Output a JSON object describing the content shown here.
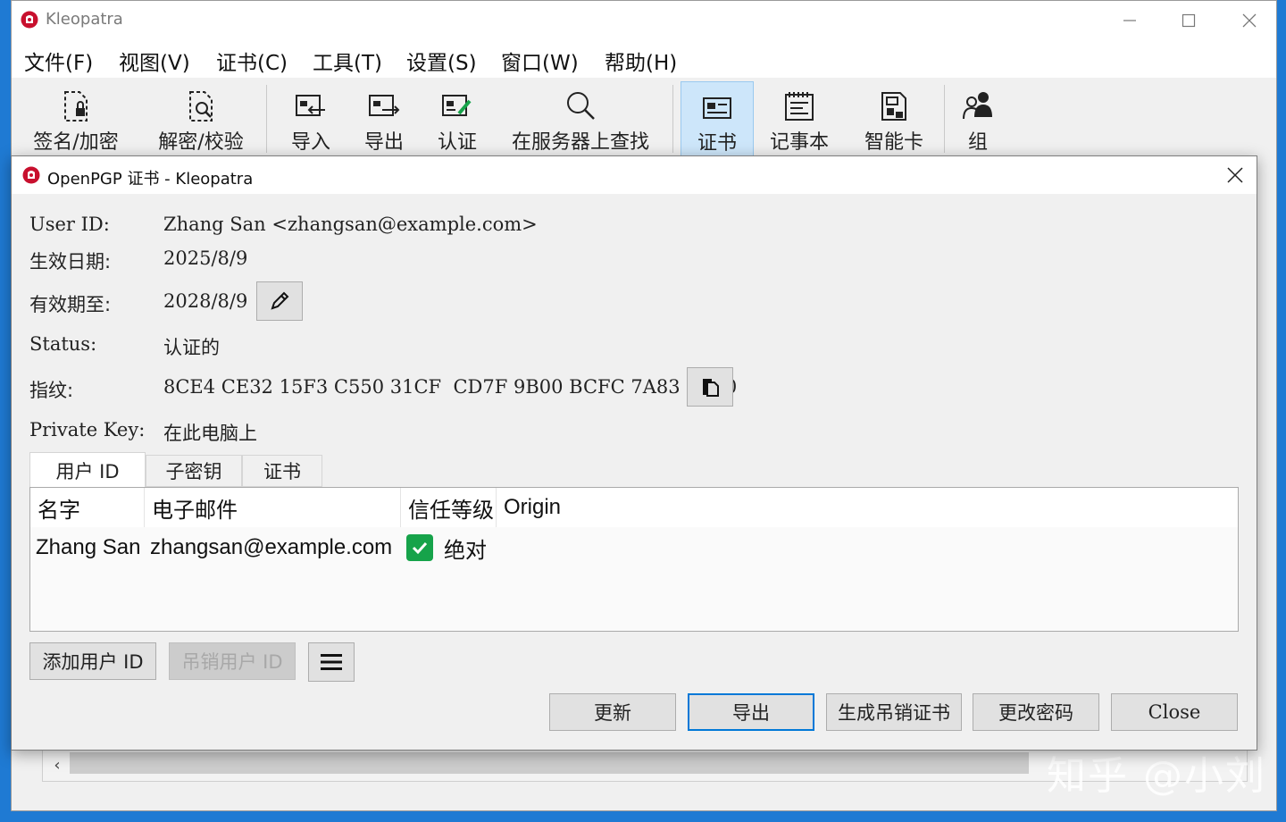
{
  "window": {
    "title": "Kleopatra",
    "minimize_glyph": "─",
    "maximize_glyph": "☐",
    "close_glyph": "✕"
  },
  "menu": [
    {
      "label": "文件(F)"
    },
    {
      "label": "视图(V)"
    },
    {
      "label": "证书(C)"
    },
    {
      "label": "工具(T)"
    },
    {
      "label": "设置(S)"
    },
    {
      "label": "窗口(W)"
    },
    {
      "label": "帮助(H)"
    }
  ],
  "toolbar": [
    {
      "label": "签名/加密",
      "icon": "sign-encrypt-icon"
    },
    {
      "label": "解密/校验",
      "icon": "decrypt-verify-icon"
    },
    {
      "label": "导入",
      "icon": "import-icon"
    },
    {
      "label": "导出",
      "icon": "export-icon"
    },
    {
      "label": "认证",
      "icon": "certify-icon"
    },
    {
      "label": "在服务器上查找",
      "icon": "search-server-icon"
    },
    {
      "label": "证书",
      "icon": "certificates-icon",
      "active": true
    },
    {
      "label": "记事本",
      "icon": "notepad-icon"
    },
    {
      "label": "智能卡",
      "icon": "smartcard-icon"
    },
    {
      "label": "组",
      "icon": "groups-icon"
    }
  ],
  "dialog": {
    "title": "OpenPGP 证书 - Kleopatra",
    "fields": {
      "user_id_label": "User ID:",
      "user_id_value": "Zhang San <zhangsan@example.com>",
      "valid_from_label": "生效日期:",
      "valid_from_value": "2025/8/9",
      "expires_label": "有效期至:",
      "expires_value": "2028/8/9",
      "status_label": "Status:",
      "status_value": "认证的",
      "fingerprint_label": "指纹:",
      "fingerprint_value": "8CE4 CE32 15F3 C550 31CF  CD7F 9B00 BCFC 7A83 D000",
      "private_key_label": "Private Key:",
      "private_key_value": "在此电脑上"
    },
    "tabs": [
      {
        "label": "用户 ID",
        "active": true
      },
      {
        "label": "子密钥",
        "active": false
      },
      {
        "label": "证书",
        "active": false
      }
    ],
    "table": {
      "columns": [
        "名字",
        "电子邮件",
        "信任等级",
        "Origin"
      ],
      "rows": [
        {
          "name": "Zhang San",
          "email": "zhangsan@example.com",
          "trust": "绝对",
          "trust_checked": true,
          "origin": ""
        }
      ]
    },
    "buttons": {
      "add_user_id": "添加用户 ID",
      "revoke_user_id": "吊销用户 ID",
      "update": "更新",
      "export": "导出",
      "gen_revocation": "生成吊销证书",
      "change_password": "更改密码",
      "close": "Close"
    }
  },
  "watermark": "知乎 @小刘",
  "colors": {
    "desktop": "#1f7ad3",
    "accent": "#0078d7",
    "logo_red": "#c8102e",
    "check_green": "#16a34a",
    "active_tool_bg": "#cde6fa"
  }
}
